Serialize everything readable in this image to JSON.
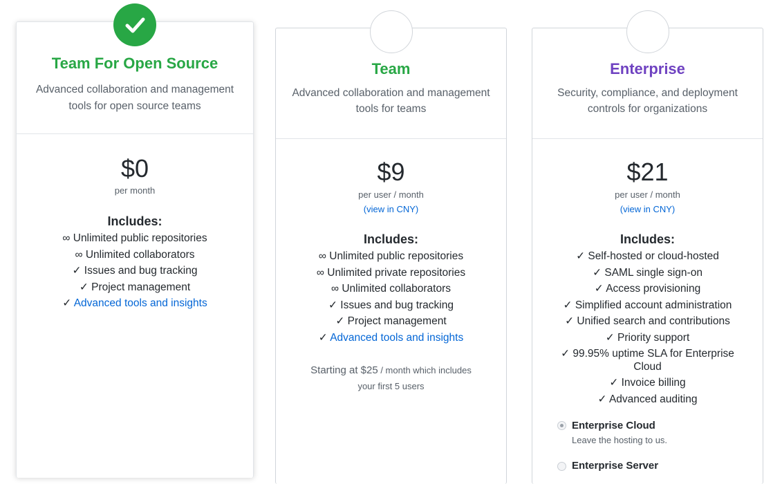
{
  "plans": [
    {
      "title": "Team For Open Source",
      "title_color": "#28a745",
      "desc_line1": "Advanced collaboration and management",
      "desc_line2": "tools for open source teams",
      "price": "$0",
      "per": "per month",
      "includes": "Includes:",
      "features": [
        "∞ Unlimited public repositories",
        "∞ Unlimited collaborators",
        "✓ Issues and bug tracking",
        "✓ Project management"
      ],
      "link_prefix": "✓ ",
      "link_text": "Advanced tools and insights",
      "icon": "check-icon"
    },
    {
      "title": "Team",
      "title_color": "#28a745",
      "desc_line1": "Advanced collaboration and management",
      "desc_line2": "tools for teams",
      "price": "$9",
      "per": "per user / month",
      "cny": "(view in CNY)",
      "includes": "Includes:",
      "features": [
        "∞ Unlimited public repositories",
        "∞ Unlimited private repositories",
        "∞ Unlimited collaborators",
        "✓ Issues and bug tracking",
        "✓ Project management"
      ],
      "link_prefix": "✓ ",
      "link_text": "Advanced tools and insights",
      "starting_big": "Starting at $25",
      "starting_small": " / month which includes",
      "starting_line2": "your first 5 users"
    },
    {
      "title": "Enterprise",
      "title_color": "#6f42c1",
      "desc_line1": "Security, compliance, and deployment",
      "desc_line2": "controls for organizations",
      "price": "$21",
      "per": "per user / month",
      "cny": "(view in CNY)",
      "includes": "Includes:",
      "features": [
        "✓ Self-hosted or cloud-hosted",
        "✓ SAML single sign-on",
        "✓ Access provisioning",
        "✓ Simplified account administration",
        "✓ Unified search and contributions",
        "✓ Priority support",
        "✓ 99.95% uptime SLA for Enterprise",
        "Cloud",
        "✓ Invoice billing",
        "✓ Advanced auditing"
      ],
      "options": [
        {
          "title": "Enterprise Cloud",
          "sub": "Leave the hosting to us.",
          "selected": true
        },
        {
          "title": "Enterprise Server",
          "sub": "",
          "selected": false
        }
      ]
    }
  ]
}
